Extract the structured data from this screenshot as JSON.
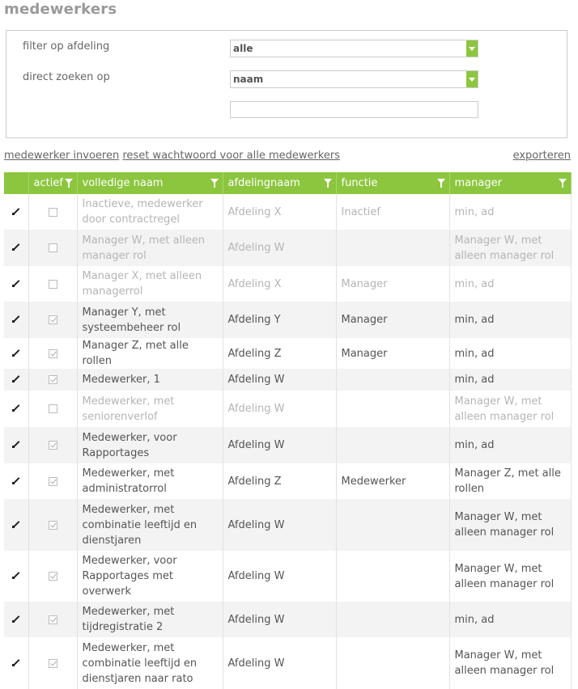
{
  "page": {
    "title": "medewerkers"
  },
  "filters": {
    "department_label": "filter op afdeling",
    "department_value": "alle",
    "search_label": "direct zoeken op",
    "search_value": "naam",
    "search_text": ""
  },
  "actions": {
    "add_employee": "medewerker invoeren",
    "reset_passwords": "reset wachtwoord voor alle medewerkers",
    "export": "exporteren"
  },
  "table": {
    "headers": {
      "active": "actief",
      "name": "volledige naam",
      "department": "afdelingnaam",
      "function": "functie",
      "manager": "manager"
    },
    "rows": [
      {
        "active": false,
        "name": "Inactieve, medewerker door contractregel",
        "department": "Afdeling X",
        "function": "Inactief",
        "manager": "min, ad"
      },
      {
        "active": false,
        "name": "Manager W, met alleen manager rol",
        "department": "Afdeling W",
        "function": "",
        "manager": "Manager W, met alleen manager rol"
      },
      {
        "active": false,
        "name": "Manager X, met alleen managerrol",
        "department": "Afdeling X",
        "function": "Manager",
        "manager": "min, ad"
      },
      {
        "active": true,
        "name": "Manager Y, met systeembeheer rol",
        "department": "Afdeling Y",
        "function": "Manager",
        "manager": "min, ad"
      },
      {
        "active": true,
        "name": "Manager Z, met alle rollen",
        "department": "Afdeling Z",
        "function": "Manager",
        "manager": "min, ad"
      },
      {
        "active": true,
        "name": "Medewerker, 1",
        "department": "Afdeling W",
        "function": "",
        "manager": "min, ad"
      },
      {
        "active": false,
        "name": "Medewerker, met seniorenverlof",
        "department": "Afdeling W",
        "function": "",
        "manager": "Manager W, met alleen manager rol"
      },
      {
        "active": true,
        "name": "Medewerker, voor Rapportages",
        "department": "Afdeling W",
        "function": "",
        "manager": "min, ad"
      },
      {
        "active": true,
        "name": "Medewerker, met administratorrol",
        "department": "Afdeling Z",
        "function": "Medewerker",
        "manager": "Manager Z, met alle rollen"
      },
      {
        "active": true,
        "name": "Medewerker, met combinatie leeftijd en dienstjaren",
        "department": "Afdeling W",
        "function": "",
        "manager": "Manager W, met alleen manager rol"
      },
      {
        "active": true,
        "name": "Medewerker, voor Rapportages met overwerk",
        "department": "Afdeling W",
        "function": "",
        "manager": "Manager W, met alleen manager rol"
      },
      {
        "active": true,
        "name": "Medewerker, met tijdregistratie 2",
        "department": "Afdeling W",
        "function": "",
        "manager": "min, ad"
      },
      {
        "active": true,
        "name": "Medewerker, met combinatie leeftijd en dienstjaren naar rato",
        "department": "Afdeling W",
        "function": "",
        "manager": "Manager W, met alleen manager rol"
      }
    ]
  },
  "colors": {
    "accent": "#8cc63f",
    "stripe": "#f3f3f3",
    "inactive_text": "#b5b5b5"
  },
  "icons": {
    "edit": "pencil-icon",
    "filter": "funnel-icon",
    "dropdown": "chevron-down-icon"
  }
}
